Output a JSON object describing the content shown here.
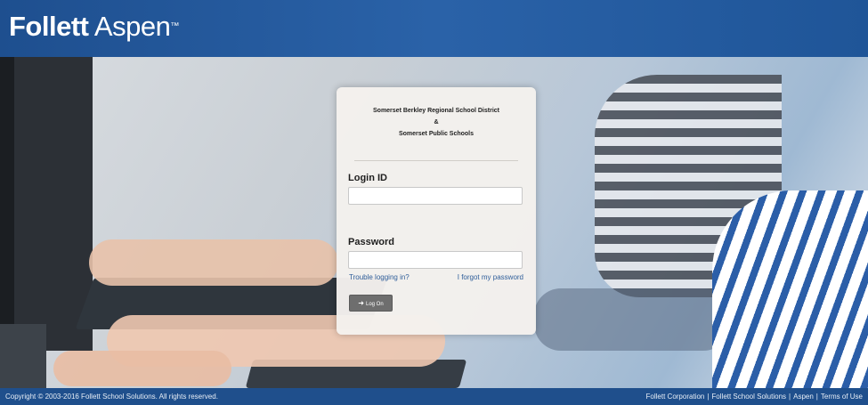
{
  "header": {
    "logo_bold": "Follett",
    "logo_light": "Aspen",
    "logo_mark": "™",
    "background_color": "#245a9f"
  },
  "login": {
    "district_line1": "Somerset Berkley Regional School District",
    "district_line2": "&",
    "district_line3": "Somerset Public Schools",
    "login_id_label": "Login ID",
    "login_id_value": "",
    "password_label": "Password",
    "password_value": "",
    "trouble_link": "Trouble logging in?",
    "forgot_link": "I forgot my password",
    "logon_button": "Log On",
    "logon_icon": "login-arrow-icon"
  },
  "footer": {
    "copyright": "Copyright © 2003-2016 Follett School Solutions. All rights reserved.",
    "links": [
      "Follett Corporation",
      "Follett School Solutions",
      "Aspen",
      "Terms of Use"
    ],
    "separator": "|"
  }
}
